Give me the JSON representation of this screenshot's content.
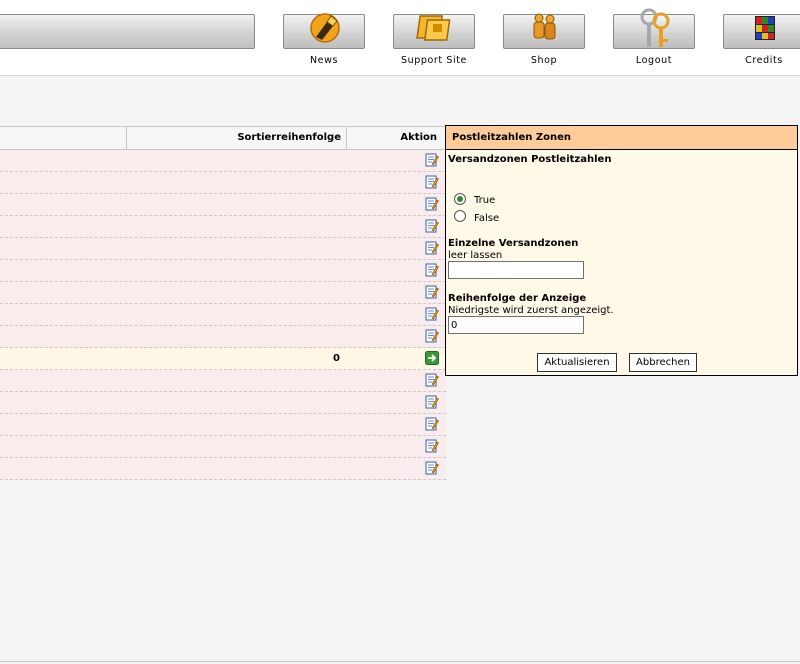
{
  "header": {
    "nav": [
      {
        "label": "News",
        "icon": "news-icon"
      },
      {
        "label": "Support Site",
        "icon": "support-site-icon"
      },
      {
        "label": "Shop",
        "icon": "shop-icon"
      },
      {
        "label": "Logout",
        "icon": "logout-icon"
      },
      {
        "label": "Credits",
        "icon": "credits-icon"
      }
    ]
  },
  "table": {
    "columns": {
      "sort_order": "Sortierreihenfolge",
      "action": "Aktion"
    },
    "rows": [
      {
        "value": "",
        "action": "edit-icon",
        "selected": false
      },
      {
        "value": "",
        "action": "edit-icon",
        "selected": false
      },
      {
        "value": "",
        "action": "edit-icon",
        "selected": false
      },
      {
        "value": "",
        "action": "edit-icon",
        "selected": false
      },
      {
        "value": "",
        "action": "edit-icon",
        "selected": false
      },
      {
        "value": "",
        "action": "edit-icon",
        "selected": false
      },
      {
        "value": "",
        "action": "edit-icon",
        "selected": false
      },
      {
        "value": "",
        "action": "edit-icon",
        "selected": false
      },
      {
        "value": "",
        "action": "edit-icon",
        "selected": false
      },
      {
        "value": "0",
        "action": "arrow-right-icon",
        "selected": true
      },
      {
        "value": "",
        "action": "edit-icon",
        "selected": false
      },
      {
        "value": "",
        "action": "edit-icon",
        "selected": false
      },
      {
        "value": "",
        "action": "edit-icon",
        "selected": false
      },
      {
        "value": "",
        "action": "edit-icon",
        "selected": false
      },
      {
        "value": "",
        "action": "edit-icon",
        "selected": false
      }
    ]
  },
  "panel": {
    "title": "Postleitzahlen Zonen",
    "field1": {
      "title": "Versandzonen Postleitzahlen",
      "options": [
        "True",
        "False"
      ],
      "selected": "True"
    },
    "field2": {
      "title": "Einzelne Versandzonen",
      "description": "leer lassen",
      "value": ""
    },
    "field3": {
      "title": "Reihenfolge der Anzeige",
      "description": "Niedrigste wird zuerst angezeigt.",
      "value": "0"
    },
    "update_label": "Aktualisieren",
    "cancel_label": "Abbrechen"
  },
  "colors": {
    "panel_header": "#ffcc99",
    "panel_bg": "#fff9e8",
    "row_bg": "#f9ecec",
    "selected_row_bg": "#fff8e6"
  }
}
